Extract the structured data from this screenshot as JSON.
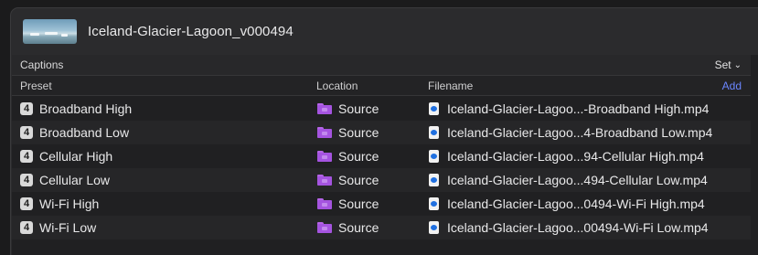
{
  "header": {
    "title": "Iceland-Glacier-Lagoon_v000494",
    "thumbnail_icon": "video-thumbnail"
  },
  "toolbar": {
    "captions_label": "Captions",
    "set_label": "Set",
    "set_icon": "chevron-down-icon"
  },
  "columns": {
    "preset": "Preset",
    "location": "Location",
    "filename": "Filename",
    "add": "Add"
  },
  "colors": {
    "accent": "#6b86ff",
    "folder": "#a554e0",
    "file_icon": "#1f6fe0"
  },
  "rows": [
    {
      "badge": "4",
      "preset": "Broadband High",
      "location": "Source",
      "filename": "Iceland-Glacier-Lagoo...-Broadband High.mp4"
    },
    {
      "badge": "4",
      "preset": "Broadband Low",
      "location": "Source",
      "filename": "Iceland-Glacier-Lagoo...4-Broadband Low.mp4"
    },
    {
      "badge": "4",
      "preset": "Cellular High",
      "location": "Source",
      "filename": "Iceland-Glacier-Lagoo...94-Cellular High.mp4"
    },
    {
      "badge": "4",
      "preset": "Cellular Low",
      "location": "Source",
      "filename": "Iceland-Glacier-Lagoo...494-Cellular Low.mp4"
    },
    {
      "badge": "4",
      "preset": "Wi-Fi High",
      "location": "Source",
      "filename": "Iceland-Glacier-Lagoo...0494-Wi-Fi High.mp4"
    },
    {
      "badge": "4",
      "preset": "Wi-Fi Low",
      "location": "Source",
      "filename": "Iceland-Glacier-Lagoo...00494-Wi-Fi Low.mp4"
    }
  ]
}
